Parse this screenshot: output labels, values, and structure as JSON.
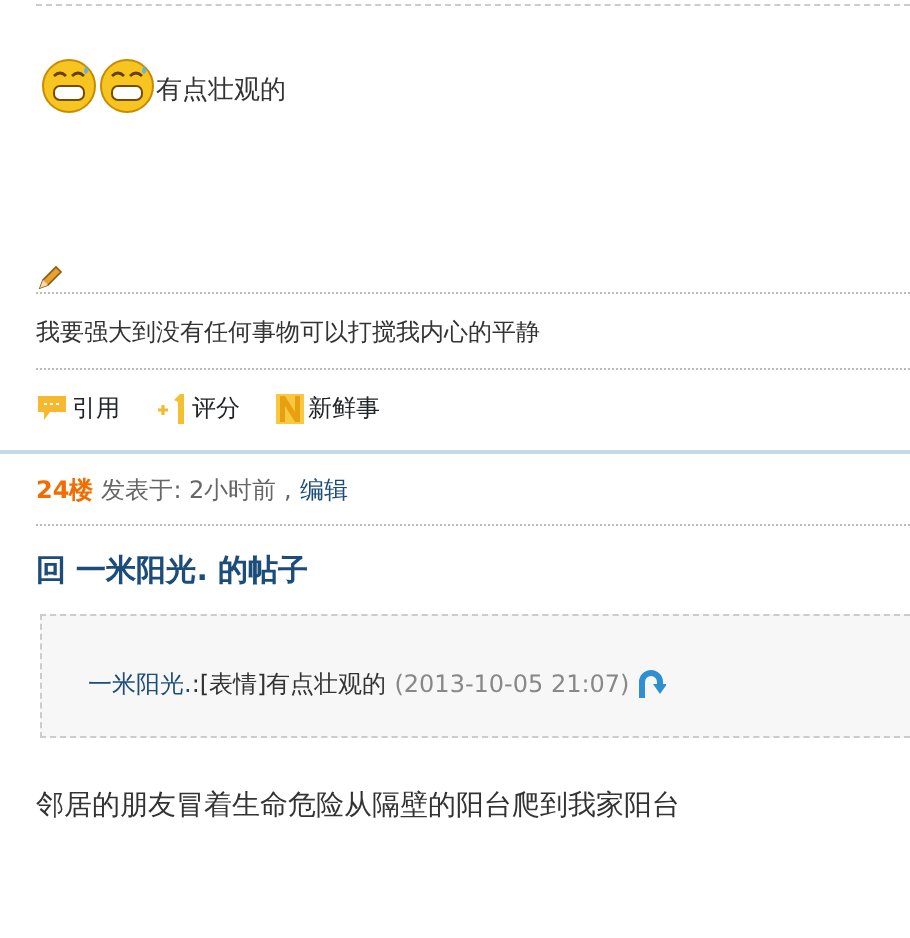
{
  "previous_post": {
    "smilies": [
      {
        "kind": "grin"
      },
      {
        "kind": "grin"
      }
    ],
    "body": "有点壮观的",
    "signature": "我要强大到没有任何事物可以打搅我内心的平静",
    "actions": [
      {
        "kind": "quote",
        "label": "引用"
      },
      {
        "kind": "rate",
        "label": "评分"
      },
      {
        "kind": "share",
        "label": "新鲜事"
      }
    ]
  },
  "post": {
    "floor": "24楼",
    "posted": "发表于: 2小时前 ,",
    "edit_link": "编辑",
    "title": "回 一米阳光. 的帖子",
    "quote": {
      "author": "一米阳光.",
      "text": ":[表情]有点壮观的",
      "time": "(2013-10-05 21:07)"
    },
    "body": "邻居的朋友冒着生命危险从隔壁的阳台爬到我家阳台"
  }
}
